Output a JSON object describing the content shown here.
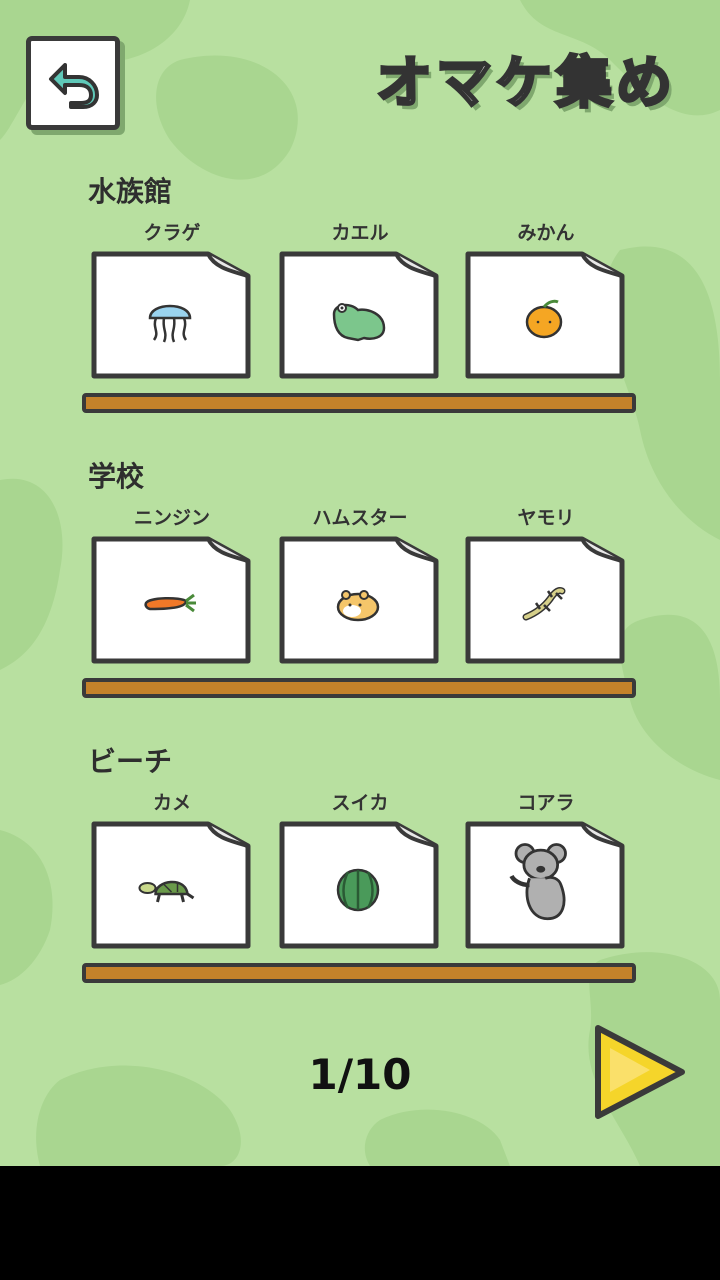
{
  "header": {
    "title": "オマケ集め"
  },
  "sections": [
    {
      "title": "水族館",
      "items": [
        {
          "label": "クラゲ",
          "icon": "jellyfish-icon"
        },
        {
          "label": "カエル",
          "icon": "frog-icon"
        },
        {
          "label": "みかん",
          "icon": "mandarin-icon"
        }
      ]
    },
    {
      "title": "学校",
      "items": [
        {
          "label": "ニンジン",
          "icon": "carrot-icon"
        },
        {
          "label": "ハムスター",
          "icon": "hamster-icon"
        },
        {
          "label": "ヤモリ",
          "icon": "gecko-icon"
        }
      ]
    },
    {
      "title": "ビーチ",
      "items": [
        {
          "label": "カメ",
          "icon": "turtle-icon"
        },
        {
          "label": "スイカ",
          "icon": "watermelon-icon"
        },
        {
          "label": "コアラ",
          "icon": "koala-icon"
        }
      ]
    }
  ],
  "pagination": {
    "current": "1/10"
  },
  "colors": {
    "background": "#b8e0a0",
    "shelf": "#c4822a",
    "next": "#f5d52a",
    "back_arrow": "#5fc8b8"
  }
}
